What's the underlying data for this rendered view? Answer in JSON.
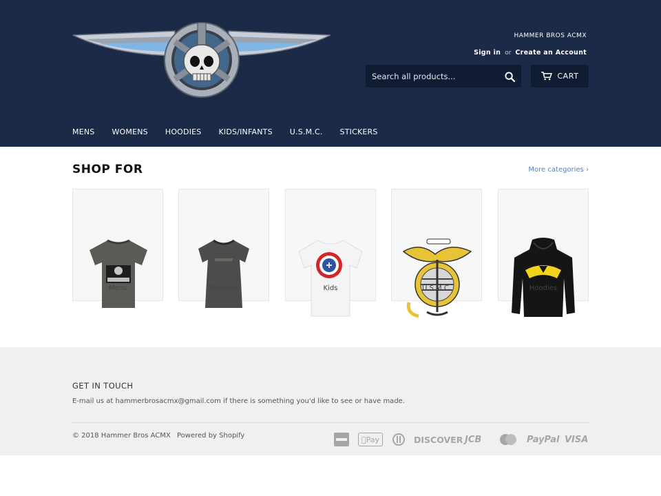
{
  "header": {
    "store_name": "HAMMER BROS ACMX",
    "sign_in": "Sign in",
    "or": "or",
    "create_account": "Create an Account",
    "search_placeholder": "Search all products...",
    "cart_label": "CART",
    "logo_icon": "winged-skull-logo"
  },
  "nav": {
    "items": [
      "MENS",
      "WOMENS",
      "HOODIES",
      "KIDS/INFANTS",
      "U.S.M.C.",
      "STICKERS"
    ]
  },
  "main": {
    "title": "SHOP FOR",
    "more_categories": "More categories ›",
    "categories": [
      {
        "label": "Mens",
        "icon": "grey-tshirt-icon"
      },
      {
        "label": "Womens",
        "icon": "dark-tshirt-icon"
      },
      {
        "label": "Kids",
        "icon": "white-shield-tshirt-icon"
      },
      {
        "label": "U.S.M.C.",
        "icon": "usmc-emblem-icon"
      },
      {
        "label": "Hoodies",
        "icon": "black-hoodie-icon"
      }
    ]
  },
  "footer": {
    "heading": "GET IN TOUCH",
    "text": "E-mail us at hammerbrosacmx@gmail.com if there is something you'd like to see or have made.",
    "copyright": "© 2018 Hammer Bros ACMX",
    "powered": "Powered by Shopify",
    "payments": [
      "american-express-icon",
      "apple-pay-icon",
      "diners-club-icon",
      "discover-icon",
      "jcb-icon",
      "master-icon",
      "paypal-icon",
      "visa-icon"
    ],
    "payment_labels": {
      "applepay": "Pay",
      "discover": "DISCOVER",
      "jcb": "JCB",
      "paypal": "PayPal",
      "visa": "VISA"
    }
  },
  "colors": {
    "header_bg": "#1b2a47",
    "search_bg": "#0f1c33",
    "link": "#5b80b2",
    "footer_bg": "#f0f0f0"
  }
}
